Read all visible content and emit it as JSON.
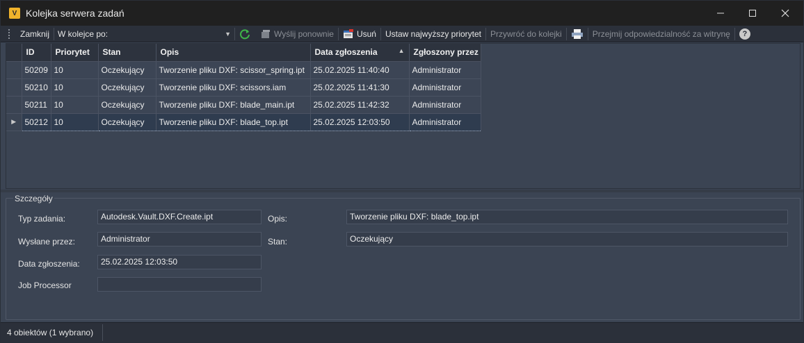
{
  "window": {
    "title": "Kolejka serwera zadań",
    "app_icon_letter": "V",
    "controls": [
      "minimize-icon",
      "maximize-icon",
      "close-icon"
    ]
  },
  "toolbar": {
    "close_label": "Zamknij",
    "filter_value": "W kolejce po:",
    "resend_label": "Wyślij ponownie",
    "delete_label": "Usuń",
    "set_priority_label": "Ustaw najwyższy priorytet",
    "restore_label": "Przywróć do kolejki",
    "take_ownership_label": "Przejmij odpowiedzialność za witrynę",
    "help_symbol": "?"
  },
  "grid": {
    "columns": [
      "ID",
      "Priorytet",
      "Stan",
      "Opis",
      "Data zgłoszenia",
      "Zgłoszony przez"
    ],
    "sorted_column": "Data zgłoszenia",
    "sort_direction": "ascending",
    "rows": [
      {
        "id": "50209",
        "priority": "10",
        "status": "Oczekujący",
        "desc": "Tworzenie pliku DXF: scissor_spring.ipt",
        "date": "25.02.2025 11:40:40",
        "by": "Administrator"
      },
      {
        "id": "50210",
        "priority": "10",
        "status": "Oczekujący",
        "desc": "Tworzenie pliku DXF: scissors.iam",
        "date": "25.02.2025 11:41:30",
        "by": "Administrator"
      },
      {
        "id": "50211",
        "priority": "10",
        "status": "Oczekujący",
        "desc": "Tworzenie pliku DXF: blade_main.ipt",
        "date": "25.02.2025 11:42:32",
        "by": "Administrator"
      },
      {
        "id": "50212",
        "priority": "10",
        "status": "Oczekujący",
        "desc": "Tworzenie pliku DXF: blade_top.ipt",
        "date": "25.02.2025 12:03:50",
        "by": "Administrator"
      }
    ],
    "selected_index": 3
  },
  "details": {
    "title": "Szczegóły",
    "job_type_label": "Typ zadania:",
    "job_type_value": "Autodesk.Vault.DXF.Create.ipt",
    "sent_by_label": "Wysłane przez:",
    "sent_by_value": "Administrator",
    "date_label": "Data zgłoszenia:",
    "date_value": "25.02.2025 12:03:50",
    "processor_label": "Job Processor",
    "processor_value": "",
    "desc_label": "Opis:",
    "desc_value": "Tworzenie pliku DXF: blade_top.ipt",
    "status_label": "Stan:",
    "status_value": "Oczekujący"
  },
  "status": {
    "text": "4 obiektów (1 wybrano)"
  },
  "colors": {
    "background": "#3b4453",
    "titlebar": "#202020",
    "refresh_green": "#3fb54a",
    "delete_red": "#d9342b"
  }
}
